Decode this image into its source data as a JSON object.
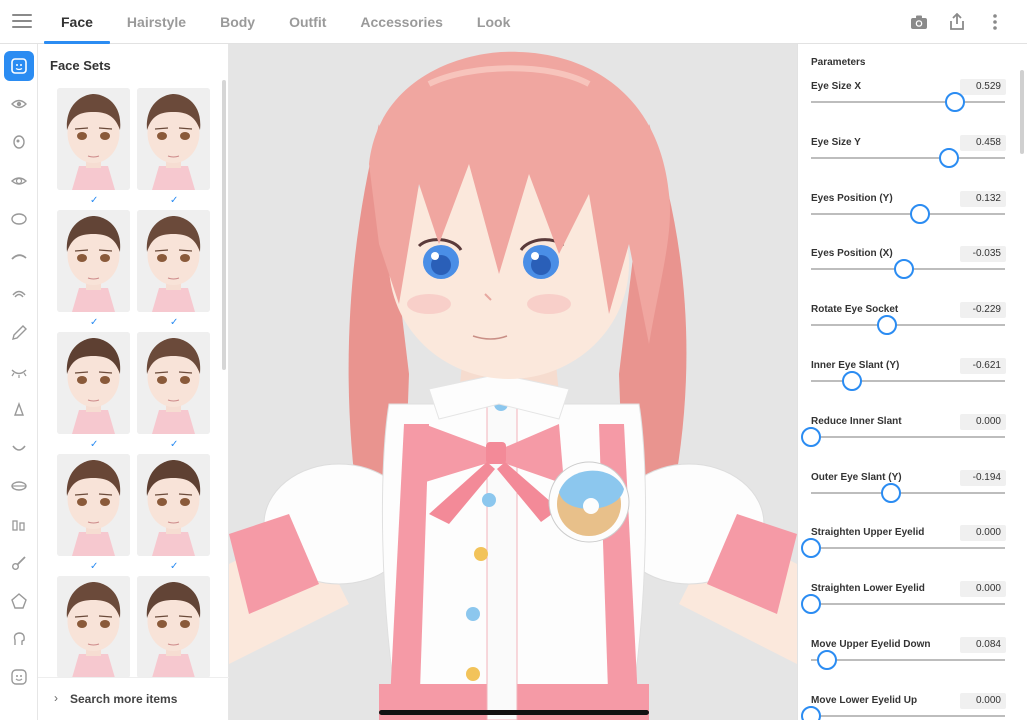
{
  "tabs": [
    "Face",
    "Hairstyle",
    "Body",
    "Outfit",
    "Accessories",
    "Look"
  ],
  "active_tab": 0,
  "top_icons": [
    "camera-icon",
    "share-icon",
    "more-vertical-icon"
  ],
  "rail_icons": [
    "face-icon",
    "eye-icon",
    "iris-icon",
    "eye-highlight-icon",
    "face-shape-icon",
    "eyebrow-icon",
    "ear-icon",
    "eyedropper-icon",
    "eyelash-icon",
    "nose-icon",
    "mouth-icon",
    "lips-icon",
    "teeth-icon",
    "brush-icon",
    "head-shape-icon",
    "head-profile-icon",
    "expression-icon"
  ],
  "sets_panel": {
    "title": "Face Sets",
    "search_more": "Search more items"
  },
  "parameters": {
    "title": "Parameters",
    "items": [
      {
        "name": "Eye Size X",
        "value": "0.529",
        "level": 0.74
      },
      {
        "name": "Eye Size Y",
        "value": "0.458",
        "level": 0.71
      },
      {
        "name": "Eyes Position (Y)",
        "value": "0.132",
        "level": 0.56
      },
      {
        "name": "Eyes Position (X)",
        "value": "-0.035",
        "level": 0.48
      },
      {
        "name": "Rotate Eye Socket",
        "value": "-0.229",
        "level": 0.39
      },
      {
        "name": "Inner Eye Slant (Y)",
        "value": "-0.621",
        "level": 0.21
      },
      {
        "name": "Reduce Inner Slant",
        "value": "0.000",
        "level": 0.0
      },
      {
        "name": "Outer Eye Slant (Y)",
        "value": "-0.194",
        "level": 0.41
      },
      {
        "name": "Straighten Upper Eyelid",
        "value": "0.000",
        "level": 0.0
      },
      {
        "name": "Straighten Lower Eyelid",
        "value": "0.000",
        "level": 0.0
      },
      {
        "name": "Move Upper Eyelid Down",
        "value": "0.084",
        "level": 0.08
      },
      {
        "name": "Move Lower Eyelid Up",
        "value": "0.000",
        "level": 0.0
      }
    ]
  },
  "colors": {
    "accent": "#2b8cf2",
    "hair": "#f0a6a0",
    "skin": "#fbe8dc",
    "eye": "#4a8ee6",
    "ribbon": "#f59aa6",
    "viewport_bg": "#e5e5e5"
  }
}
